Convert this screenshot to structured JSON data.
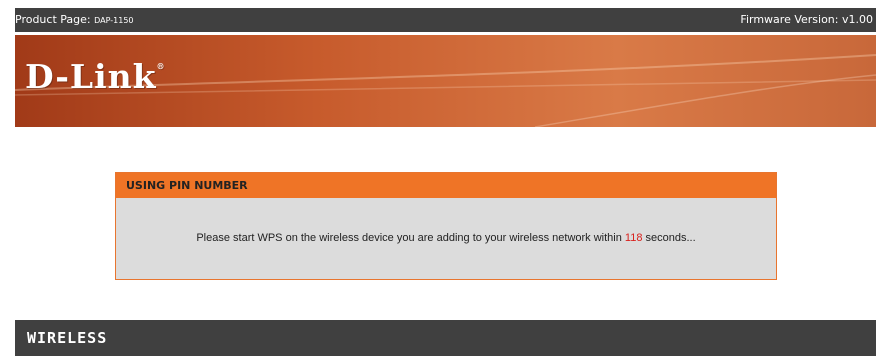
{
  "header": {
    "product_label": "Product Page:",
    "product_model": "DAP-1150",
    "firmware": "Firmware Version: v1.00"
  },
  "brand": {
    "logo_text": "D-Link",
    "logo_mark": "®"
  },
  "wps_panel": {
    "title": "USING PIN NUMBER",
    "message_before": "Please start WPS on the wireless device you are adding to your wireless network within ",
    "seconds": "118",
    "message_after": " seconds..."
  },
  "footer": {
    "section_label": "WIRELESS"
  },
  "colors": {
    "bar": "#404040",
    "panel_header": "#ef7426",
    "panel_body": "#dcdcdc",
    "countdown": "#d9201c"
  }
}
